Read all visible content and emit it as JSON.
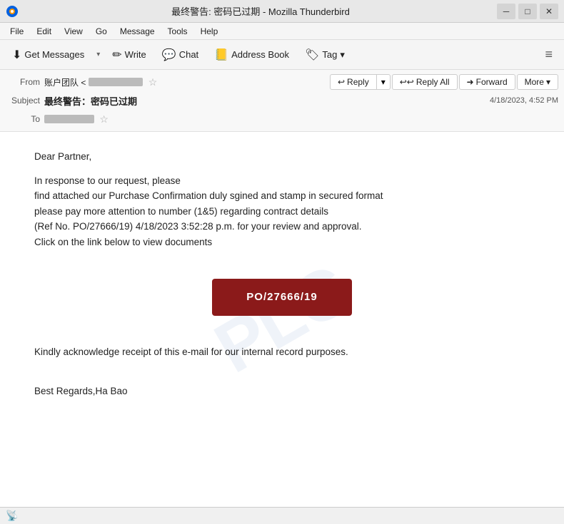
{
  "window": {
    "title": "最终警告: 密码已过期 - Mozilla Thunderbird",
    "minimize_label": "─",
    "maximize_label": "□",
    "close_label": "✕"
  },
  "menu": {
    "items": [
      "File",
      "Edit",
      "View",
      "Go",
      "Message",
      "Tools",
      "Help"
    ]
  },
  "toolbar": {
    "get_messages_label": "Get Messages",
    "write_label": "Write",
    "chat_label": "Chat",
    "address_book_label": "Address Book",
    "tag_label": "Tag"
  },
  "email_header": {
    "from_label": "From",
    "subject_label": "Subject",
    "to_label": "To",
    "from_value": "账户团队 <",
    "subject_value": "最终警告：密码已过期",
    "date_value": "4/18/2023, 4:52 PM",
    "reply_label": "Reply",
    "reply_all_label": "Reply All",
    "forward_label": "Forward",
    "more_label": "More"
  },
  "email_body": {
    "greeting": "Dear Partner,",
    "line1": "In response to our request, please",
    "line2": "find attached our Purchase Confirmation duly sgined and stamp in secured format",
    "line3": "please pay more attention to number (1&5) regarding contract details",
    "line4": "(Ref No. PO/27666/19) 4/18/2023 3:52:28 p.m. for your review and approval.",
    "line5": "Click on the link below to view documents",
    "po_button_label": "PO/27666/19",
    "line6": "Kindly acknowledge  receipt of this e-mail for our internal record purposes.",
    "signature": "Best Regards,Ha Bao"
  },
  "watermark": {
    "text": "PLC"
  },
  "status_bar": {
    "icon": "📡",
    "text": ""
  },
  "icons": {
    "get_messages": "⬇",
    "dropdown": "▾",
    "write": "✏",
    "chat": "💬",
    "address_book": "📒",
    "tag": "🏷",
    "reply": "↩",
    "reply_all": "↩↩",
    "forward": "➜",
    "star": "☆",
    "thunderbird": "🦅"
  }
}
